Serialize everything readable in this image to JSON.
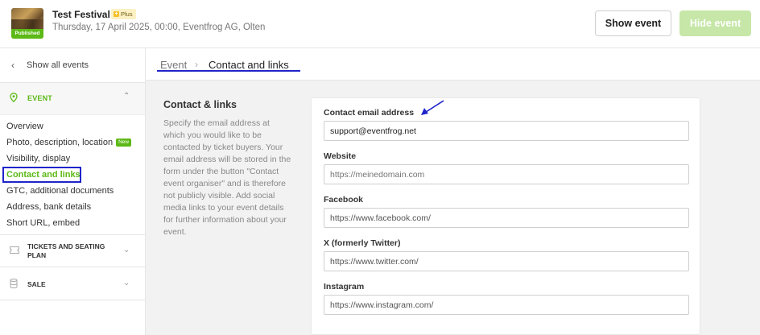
{
  "header": {
    "event_title": "Test Festival",
    "plan_badge": "Plus",
    "event_subtitle": "Thursday, 17 April 2025, 00:00, Eventfrog AG, Olten",
    "status_badge": "Published",
    "show_event_label": "Show event",
    "hide_event_label": "Hide event"
  },
  "sidebar": {
    "back_label": "Show all events",
    "event_section_label": "EVENT",
    "items": [
      {
        "label": "Overview"
      },
      {
        "label": "Photo, description, location",
        "badge": "New"
      },
      {
        "label": "Visibility, display"
      },
      {
        "label": "Contact and links"
      },
      {
        "label": "GTC, additional documents"
      },
      {
        "label": "Address, bank details"
      },
      {
        "label": "Short URL, embed"
      }
    ],
    "tickets_section_line1": "TICKETS AND SEATING",
    "tickets_section_line2": "PLAN",
    "sale_section_label": "SALE"
  },
  "breadcrumb": {
    "parent": "Event",
    "separator": "›",
    "current": "Contact and links"
  },
  "description": {
    "title": "Contact & links",
    "text": "Specify the email address at which you would like to be contacted by ticket buyers. Your email address will be stored in the form under the button \"Contact event organiser\" and is therefore not publicly visible. Add social media links to your event details for further information about your event."
  },
  "form": {
    "email": {
      "label": "Contact email address",
      "value": "support@eventfrog.net"
    },
    "website": {
      "label": "Website",
      "placeholder": "https://meinedomain.com"
    },
    "facebook": {
      "label": "Facebook",
      "value": "https://www.facebook.com/"
    },
    "twitter": {
      "label": "X (formerly Twitter)",
      "value": "https://www.twitter.com/"
    },
    "instagram": {
      "label": "Instagram",
      "value": "https://www.instagram.com/"
    }
  },
  "colors": {
    "accent_green": "#5cb916",
    "annotation_blue": "#1f24c9"
  }
}
